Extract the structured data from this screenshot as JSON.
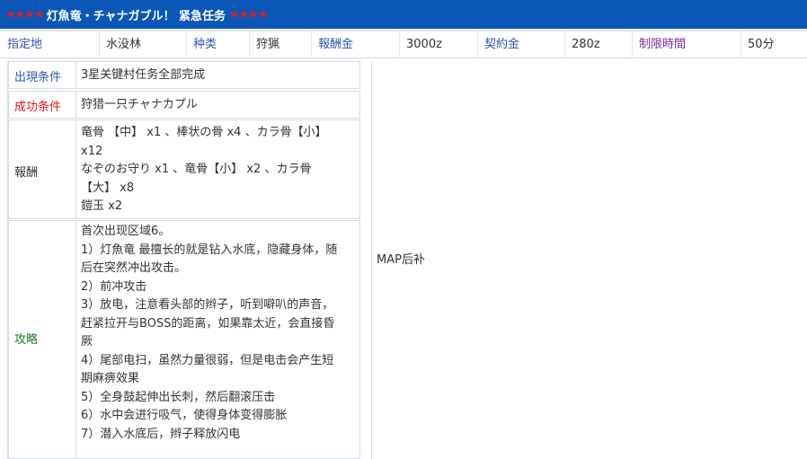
{
  "title": {
    "stars_left": "★★★★",
    "text": "灯魚竜・チャナガブル！ 紧急任务",
    "stars_right": "★★★★"
  },
  "info": {
    "location_label": "指定地",
    "location_value": "水没林",
    "type_label": "种类",
    "type_value": "狩猟",
    "reward_label": "報酬金",
    "reward_value": "3000z",
    "contract_label": "契約金",
    "contract_value": "280z",
    "time_label": "制限時間",
    "time_value": "50分"
  },
  "rows": {
    "appear_label": "出現条件",
    "appear_value": "3星关键村任务全部完成",
    "success_label": "成功条件",
    "success_value": "狩猎一只チャナカプル",
    "reward_label": "報酬",
    "reward_lines": [
      "竜骨 【中】 x1 、棒状の骨 x4 、カラ骨【小】",
      "x12",
      "なぞのお守り x1 、竜骨【小】 x2 、カラ骨",
      "【大】 x8",
      "鎧玉 x2"
    ],
    "strategy_label": "攻略",
    "strategy_lines": [
      "首次出现区域6。",
      "1）灯魚竜 最擅长的就是钻入水底，隐藏身体，随",
      "后在突然冲出攻击。",
      "2）前冲攻击",
      "3）放电，注意看头部的辫子，听到噼叭的声音，",
      "赶紧拉开与BOSS的距离，如果靠太近，会直接昏",
      "厥",
      "4）尾部电扫，虽然力量很弱，但是电击会产生短",
      "期麻痹效果",
      "5）全身鼓起伸出长刺，然后翻滚压击",
      "6）水中会进行吸气，使得身体变得膨胀",
      "7）潜入水底后，辫子释放闪电"
    ]
  },
  "map_note": "MAP后补",
  "colors": {
    "title_bg": "#0a57b8",
    "stars": "#e81a1a",
    "label_blue": "#2a57b4",
    "label_purple": "#7a2aa2",
    "label_red": "#e01a1a",
    "label_green": "#1a7a1a"
  }
}
